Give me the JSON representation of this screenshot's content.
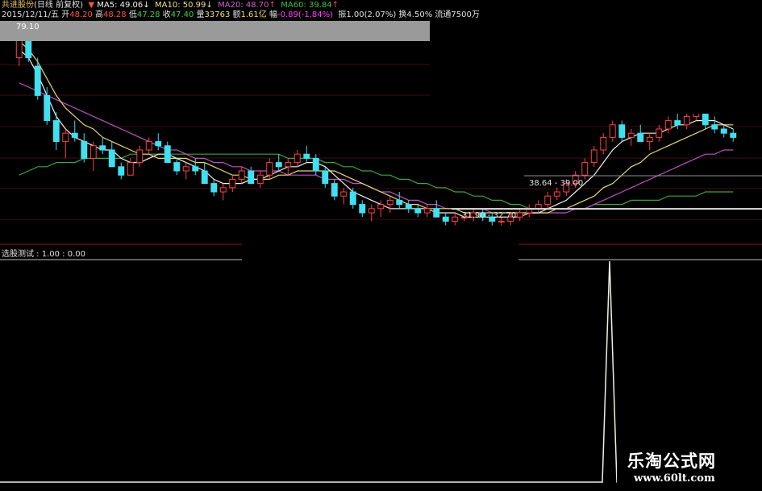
{
  "header": {
    "stock_name": "共进股份",
    "period": "(日线 前复权)",
    "ma5_label": "MA5: 49.06",
    "ma10_label": "MA10: 50.99",
    "ma20_label": "MA20: 48.70",
    "ma60_label": "MA60: 39.84",
    "date": "2015/12/11/五",
    "open_label": "开",
    "open_val": "48.20",
    "high_label": "高",
    "high_val": "48.28",
    "low_label": "低",
    "low_val": "47.28",
    "close_label": "收",
    "close_val": "47.40",
    "vol_label": "量",
    "vol_val": "33763",
    "amt_label": "额",
    "amt_val": "1.61亿",
    "chg_label": "幅",
    "chg_val": "-0.89(-1.84%)",
    "amp_label": "振",
    "amp_val": "1.00(2.07%)",
    "turn_label": "换",
    "turn_val": "4.50%",
    "float_label": "流通",
    "float_val": "7500万"
  },
  "chart_labels": {
    "high_mark": "79.10",
    "low_range": "31.90 - 32.70",
    "mid_range": "38.64 - 39.00",
    "indicator_name": "选股测试 : 1.00 : 0.00"
  },
  "watermark": {
    "site_name": "乐淘公式网",
    "url": "www.60lt.com"
  },
  "colors": {
    "up": "#ff4040",
    "down": "#40e0f0",
    "ma5": "#f0f0f0",
    "ma10": "#e8d870",
    "ma20": "#c050c0",
    "ma60": "#40a040",
    "indicator": "#f0f0e0"
  },
  "chart_data": {
    "type": "candlestick",
    "value_range": [
      30,
      80
    ],
    "candles": [
      [
        72,
        79,
        70,
        78
      ],
      [
        77,
        79,
        71,
        72
      ],
      [
        70,
        72,
        62,
        63
      ],
      [
        63,
        65,
        56,
        57
      ],
      [
        57,
        59,
        50,
        52
      ],
      [
        52,
        55,
        48,
        54
      ],
      [
        54,
        57,
        52,
        53
      ],
      [
        52,
        54,
        47,
        48
      ],
      [
        48,
        52,
        45,
        51
      ],
      [
        51,
        53,
        49,
        50
      ],
      [
        50,
        52,
        46,
        46
      ],
      [
        46,
        47,
        43,
        44
      ],
      [
        44,
        48,
        44,
        47
      ],
      [
        47,
        51,
        46,
        50
      ],
      [
        50,
        53,
        49,
        52
      ],
      [
        52,
        54,
        50,
        51
      ],
      [
        51,
        52,
        47,
        47
      ],
      [
        47,
        48,
        44,
        45
      ],
      [
        45,
        47,
        43,
        46
      ],
      [
        46,
        48,
        44,
        45
      ],
      [
        45,
        47,
        42,
        42
      ],
      [
        42,
        43,
        39,
        40
      ],
      [
        40,
        42,
        38,
        41
      ],
      [
        41,
        44,
        40,
        43
      ],
      [
        43,
        46,
        42,
        45
      ],
      [
        45,
        46,
        42,
        42
      ],
      [
        42,
        45,
        41,
        44
      ],
      [
        44,
        48,
        43,
        47
      ],
      [
        47,
        49,
        45,
        46
      ],
      [
        46,
        48,
        44,
        47
      ],
      [
        47,
        50,
        46,
        49
      ],
      [
        49,
        51,
        47,
        48
      ],
      [
        48,
        49,
        44,
        45
      ],
      [
        45,
        46,
        41,
        42
      ],
      [
        42,
        43,
        38,
        39
      ],
      [
        39,
        41,
        37,
        40
      ],
      [
        40,
        41,
        36,
        37
      ],
      [
        37,
        38,
        34,
        35
      ],
      [
        35,
        37,
        33,
        36
      ],
      [
        36,
        38,
        34,
        37
      ],
      [
        37,
        39,
        35,
        38
      ],
      [
        38,
        40,
        36,
        37
      ],
      [
        37,
        38,
        35,
        36
      ],
      [
        36,
        37,
        34,
        35
      ],
      [
        35,
        37,
        34,
        36
      ],
      [
        36,
        38,
        34,
        34
      ],
      [
        34,
        35,
        32,
        33
      ],
      [
        33,
        35,
        32,
        34
      ],
      [
        34,
        35,
        33,
        34
      ],
      [
        34,
        36,
        33,
        35
      ],
      [
        35,
        36,
        33,
        34
      ],
      [
        34,
        35,
        32,
        33
      ],
      [
        33,
        34,
        32,
        33
      ],
      [
        33,
        35,
        32,
        34
      ],
      [
        34,
        36,
        33,
        35
      ],
      [
        35,
        37,
        34,
        36
      ],
      [
        36,
        38,
        35,
        37
      ],
      [
        37,
        40,
        36,
        39
      ],
      [
        39,
        41,
        38,
        40
      ],
      [
        40,
        43,
        39,
        42
      ],
      [
        42,
        45,
        41,
        44
      ],
      [
        44,
        48,
        43,
        47
      ],
      [
        47,
        51,
        46,
        50
      ],
      [
        50,
        54,
        49,
        53
      ],
      [
        53,
        57,
        52,
        56
      ],
      [
        56,
        57,
        52,
        53
      ],
      [
        53,
        55,
        51,
        54
      ],
      [
        54,
        56,
        52,
        52
      ],
      [
        52,
        54,
        50,
        53
      ],
      [
        53,
        56,
        52,
        55
      ],
      [
        55,
        58,
        54,
        57
      ],
      [
        57,
        59,
        55,
        56
      ],
      [
        56,
        59,
        55,
        58
      ],
      [
        58,
        60,
        57,
        59
      ],
      [
        59,
        60,
        55,
        56
      ],
      [
        56,
        58,
        54,
        55
      ],
      [
        55,
        56,
        53,
        54
      ],
      [
        54,
        55,
        52,
        53
      ]
    ],
    "ma5": [
      74,
      72,
      68,
      63,
      58,
      55,
      53,
      52,
      51,
      50,
      50,
      48,
      47,
      47,
      48,
      49,
      49,
      48,
      47,
      46,
      45,
      43,
      42,
      42,
      42,
      43,
      43,
      44,
      45,
      46,
      46,
      47,
      47,
      46,
      44,
      42,
      40,
      39,
      38,
      37,
      36,
      36,
      36,
      36,
      36,
      35,
      35,
      35,
      34,
      34,
      34,
      34,
      34,
      34,
      34,
      35,
      35,
      36,
      37,
      38,
      40,
      42,
      44,
      47,
      50,
      52,
      53,
      54,
      54,
      54,
      55,
      56,
      56,
      57,
      57,
      57,
      56,
      55
    ],
    "ma10": [
      76,
      74,
      71,
      67,
      63,
      60,
      58,
      56,
      55,
      53,
      52,
      51,
      50,
      49,
      49,
      48,
      48,
      48,
      48,
      47,
      47,
      46,
      45,
      44,
      44,
      43,
      43,
      43,
      44,
      44,
      45,
      45,
      45,
      45,
      45,
      44,
      43,
      42,
      41,
      40,
      39,
      38,
      37,
      37,
      36,
      36,
      36,
      36,
      35,
      35,
      35,
      35,
      35,
      35,
      35,
      35,
      35,
      35,
      36,
      36,
      37,
      38,
      39,
      41,
      42,
      44,
      46,
      47,
      49,
      50,
      51,
      52,
      53,
      54,
      55,
      56,
      56,
      56
    ],
    "ma20": [
      66,
      65,
      64,
      63,
      62,
      61,
      60,
      59,
      58,
      57,
      56,
      55,
      54,
      53,
      52,
      51,
      50,
      50,
      49,
      48,
      48,
      47,
      47,
      46,
      46,
      45,
      45,
      45,
      45,
      44,
      44,
      44,
      44,
      43,
      43,
      43,
      42,
      42,
      41,
      40,
      40,
      39,
      38,
      38,
      37,
      37,
      36,
      36,
      36,
      36,
      36,
      35,
      35,
      35,
      35,
      35,
      35,
      35,
      35,
      35,
      36,
      36,
      37,
      38,
      39,
      40,
      41,
      42,
      43,
      44,
      45,
      46,
      47,
      48,
      49,
      49,
      50,
      50
    ],
    "ma60": [
      44,
      45,
      46,
      46,
      47,
      47,
      47,
      48,
      48,
      48,
      48,
      48,
      49,
      49,
      49,
      49,
      49,
      49,
      49,
      49,
      49,
      49,
      49,
      49,
      49,
      49,
      49,
      49,
      49,
      48,
      48,
      48,
      48,
      47,
      47,
      46,
      46,
      45,
      45,
      44,
      44,
      43,
      43,
      42,
      42,
      41,
      41,
      40,
      40,
      39,
      39,
      38,
      38,
      37,
      37,
      36,
      36,
      36,
      36,
      36,
      36,
      36,
      37,
      37,
      37,
      37,
      38,
      38,
      38,
      38,
      39,
      39,
      39,
      39,
      40,
      40,
      40,
      40
    ],
    "indicator": {
      "signal_value": 1,
      "base_value": 0,
      "signal_position": 0.8
    }
  }
}
